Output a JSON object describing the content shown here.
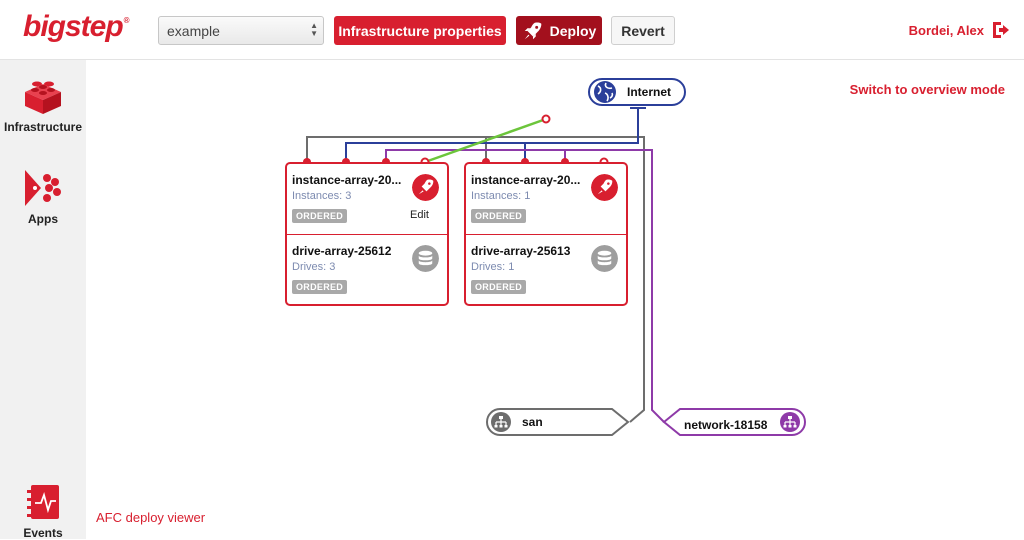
{
  "header": {
    "logo": "bigstep",
    "logo_mark": "®",
    "environment": "example",
    "infra_button": "Infrastructure properties",
    "deploy_button": "Deploy",
    "revert_button": "Revert",
    "user_name": "Bordei, Alex"
  },
  "sidebar": {
    "items": [
      {
        "label": "Infrastructure",
        "icon": "lego-brick-icon"
      },
      {
        "label": "Apps",
        "icon": "apps-icon"
      },
      {
        "label": "Events",
        "icon": "events-notebook-icon"
      }
    ]
  },
  "canvas": {
    "overview_link": "Switch to overview mode",
    "footer_link": "AFC deploy viewer",
    "internet": {
      "label": "Internet",
      "icon": "globe-icon"
    },
    "groups": [
      {
        "instance_array": {
          "title": "instance-array-20...",
          "sub": "Instances: 3",
          "status": "ORDERED",
          "edit": "Edit"
        },
        "drive_array": {
          "title": "drive-array-25612",
          "sub": "Drives: 3",
          "status": "ORDERED"
        }
      },
      {
        "instance_array": {
          "title": "instance-array-20...",
          "sub": "Instances: 1",
          "status": "ORDERED"
        },
        "drive_array": {
          "title": "drive-array-25613",
          "sub": "Drives: 1",
          "status": "ORDERED"
        }
      }
    ],
    "networks": [
      {
        "label": "san",
        "icon": "network-icon"
      },
      {
        "label": "network-18158",
        "icon": "network-icon"
      }
    ]
  },
  "colors": {
    "brand": "#d81f2f",
    "deploy": "#a3101d",
    "internet_line": "#2b3f9a",
    "san_line": "#6d6d6d",
    "network_line": "#8e3aa8",
    "wan_line": "#6cc53b"
  }
}
